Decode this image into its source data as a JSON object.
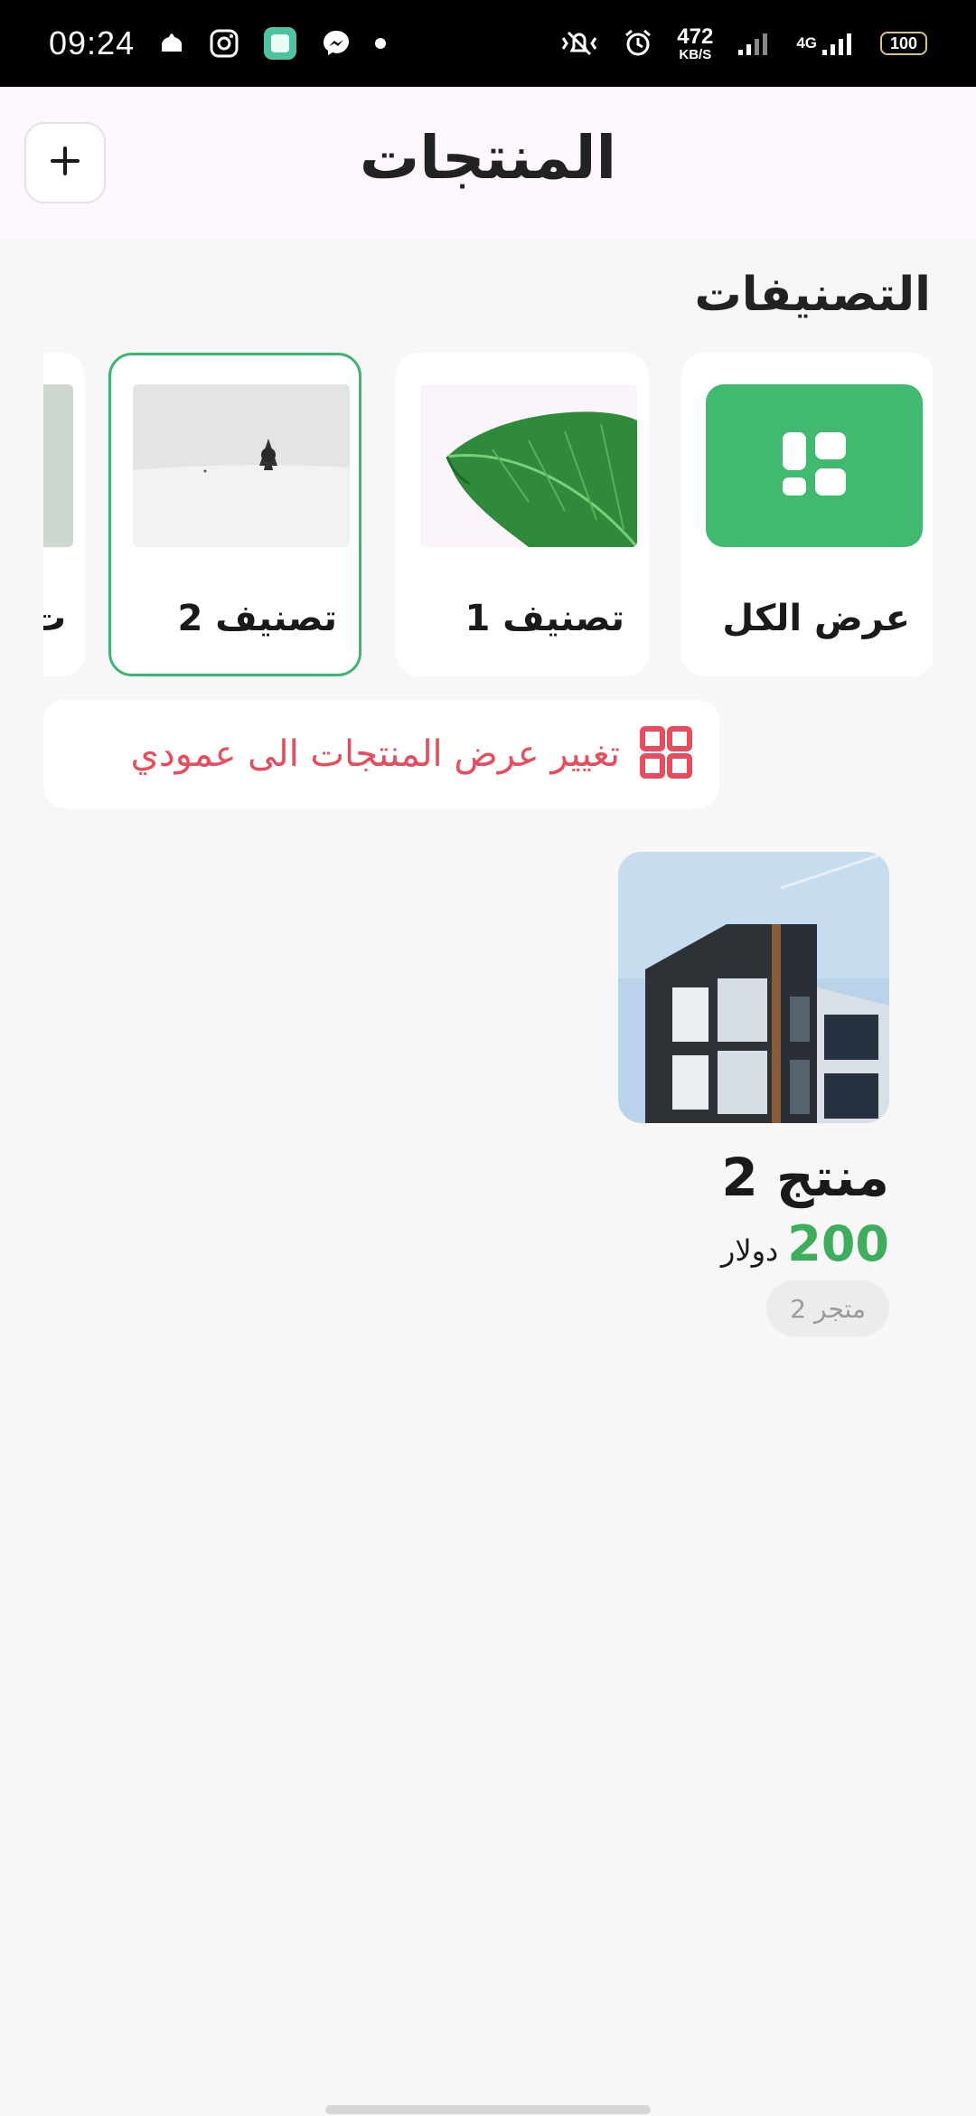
{
  "status_bar": {
    "time": "09:24",
    "net_speed_value": "472",
    "net_speed_unit": "KB/S",
    "network_type": "4G",
    "battery": "100"
  },
  "header": {
    "title": "المنتجات",
    "add_button_label": "+"
  },
  "categories_section": {
    "title": "التصنيفات",
    "items": [
      {
        "label": "عرض الكل",
        "icon": "grid-icon",
        "selected": false
      },
      {
        "label": "تصنيف 1",
        "icon": "leaf-image",
        "selected": false
      },
      {
        "label": "تصنيف 2",
        "icon": "snow-tree-image",
        "selected": true
      },
      {
        "label": "ت",
        "icon": "partial-image",
        "selected": false
      }
    ]
  },
  "view_toggle": {
    "label": "تغيير عرض المنتجات الى عمودي",
    "icon": "grid-view-icon"
  },
  "products": [
    {
      "name": "منتج 2",
      "price": "200",
      "currency": "دولار",
      "store": "متجر 2",
      "image": "building-image"
    }
  ],
  "colors": {
    "accent_green": "#3fba6f",
    "selected_border": "#3cb670",
    "price_green": "#3fae5c",
    "toggle_red": "#e84c5d",
    "header_bg": "#fdf7fd",
    "page_bg": "#f7f7f7"
  }
}
